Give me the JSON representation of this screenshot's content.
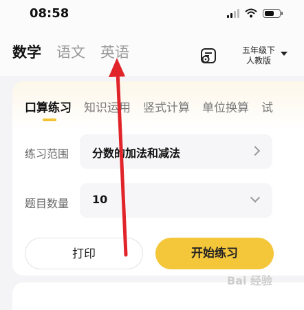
{
  "status_bar": {
    "time": "08:58"
  },
  "header": {
    "tabs": [
      {
        "label": "数学",
        "active": true
      },
      {
        "label": "语文",
        "active": false
      },
      {
        "label": "英语",
        "active": false
      }
    ],
    "grade_line1": "五年级下",
    "grade_line2": "人教版"
  },
  "subtabs": [
    {
      "label": "口算练习",
      "active": true
    },
    {
      "label": "知识运用",
      "active": false
    },
    {
      "label": "竖式计算",
      "active": false
    },
    {
      "label": "单位换算",
      "active": false
    },
    {
      "label": "试",
      "active": false
    }
  ],
  "form": {
    "range_label": "练习范围",
    "range_value": "分数的加法和减法",
    "count_label": "题目数量",
    "count_value": "10"
  },
  "buttons": {
    "print": "打印",
    "start": "开始练习"
  },
  "watermark": "Bai 经验",
  "colors": {
    "accent": "#f4c63a",
    "arrow": "#e0242a"
  }
}
